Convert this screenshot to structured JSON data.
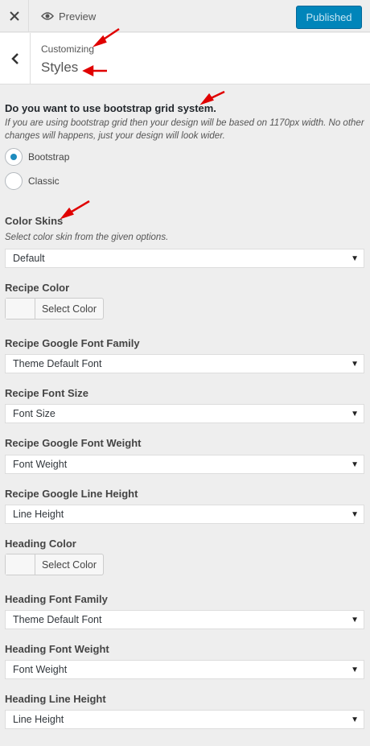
{
  "topbar": {
    "close_icon": "close-icon",
    "preview_label": "Preview",
    "published_label": "Published"
  },
  "section": {
    "breadcrumb": "Customizing",
    "title": "Styles"
  },
  "grid": {
    "title": "Do you want to use bootstrap grid system.",
    "description": "If you are using bootstrap grid then your design will be based on 1170px width. No other changes will happens, just your design will look wider.",
    "options": [
      {
        "label": "Bootstrap",
        "selected": true
      },
      {
        "label": "Classic",
        "selected": false
      }
    ]
  },
  "controls": {
    "color_skins": {
      "label": "Color Skins",
      "description": "Select color skin from the given options.",
      "value": "Default"
    },
    "recipe_color": {
      "label": "Recipe Color",
      "button": "Select Color"
    },
    "recipe_font_family": {
      "label": "Recipe Google Font Family",
      "value": "Theme Default Font"
    },
    "recipe_font_size": {
      "label": "Recipe Font Size",
      "value": "Font Size"
    },
    "recipe_font_weight": {
      "label": "Recipe Google Font Weight",
      "value": "Font Weight"
    },
    "recipe_line_height": {
      "label": "Recipe Google Line Height",
      "value": "Line Height"
    },
    "heading_color": {
      "label": "Heading Color",
      "button": "Select Color"
    },
    "heading_font_family": {
      "label": "Heading Font Family",
      "value": "Theme Default Font"
    },
    "heading_font_weight": {
      "label": "Heading Font Weight",
      "value": "Font Weight"
    },
    "heading_line_height": {
      "label": "Heading Line Height",
      "value": "Line Height"
    }
  },
  "colors": {
    "accent": "#0085ba",
    "radio_selected": "#1e8cbe",
    "annotation_arrow": "#e00000"
  }
}
